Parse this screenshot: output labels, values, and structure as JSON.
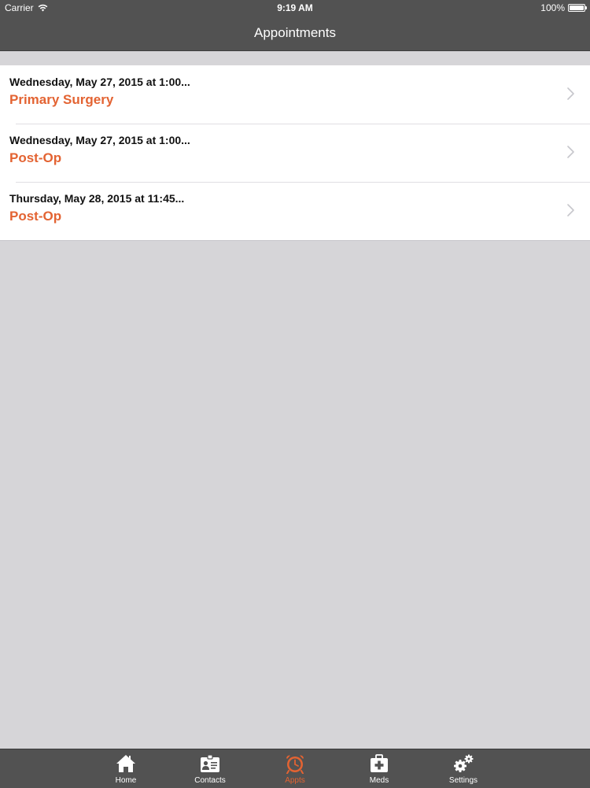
{
  "status_bar": {
    "carrier": "Carrier",
    "time": "9:19 AM",
    "battery": "100%",
    "battery_level": 1.0
  },
  "nav": {
    "title": "Appointments"
  },
  "appointments": [
    {
      "date": "Wednesday, May 27, 2015 at 1:00...",
      "type": "Primary Surgery"
    },
    {
      "date": "Wednesday, May 27, 2015 at 1:00...",
      "type": "Post-Op"
    },
    {
      "date": "Thursday, May 28, 2015 at 11:45...",
      "type": "Post-Op"
    }
  ],
  "tabs": [
    {
      "label": "Home",
      "icon": "home-icon"
    },
    {
      "label": "Contacts",
      "icon": "contacts-icon"
    },
    {
      "label": "Appts",
      "icon": "alarm-clock-icon",
      "active": true
    },
    {
      "label": "Meds",
      "icon": "medical-kit-icon"
    },
    {
      "label": "Settings",
      "icon": "gears-icon"
    }
  ],
  "colors": {
    "accent": "#e36332",
    "bar_background": "#525252",
    "page_background": "#d6d5d8",
    "list_background": "#ffffff"
  }
}
